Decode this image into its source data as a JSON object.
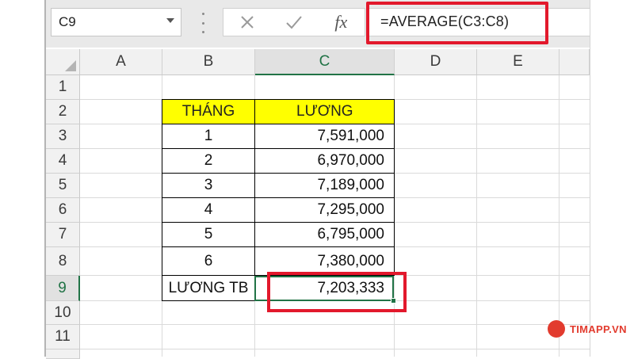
{
  "name_box": {
    "value": "C9"
  },
  "formula_bar": {
    "cancel_icon": "close-icon",
    "enter_icon": "check-icon",
    "function_label": "fx",
    "formula": "=AVERAGE(C3:C8)"
  },
  "columns": [
    "A",
    "B",
    "C",
    "D",
    "E"
  ],
  "selected_column": "C",
  "rows": [
    "1",
    "2",
    "3",
    "4",
    "5",
    "6",
    "7",
    "8",
    "9",
    "10",
    "11"
  ],
  "selected_row": "9",
  "table": {
    "headers": {
      "month": "THÁNG",
      "salary": "LƯƠNG"
    },
    "rows": [
      {
        "month": "1",
        "salary": "7,591,000"
      },
      {
        "month": "2",
        "salary": "6,970,000"
      },
      {
        "month": "3",
        "salary": "7,189,000"
      },
      {
        "month": "4",
        "salary": "7,295,000"
      },
      {
        "month": "5",
        "salary": "6,795,000"
      },
      {
        "month": "6",
        "salary": "7,380,000"
      }
    ],
    "summary": {
      "label": "LƯƠNG TB",
      "value": "7,203,333"
    }
  },
  "colors": {
    "header_fill": "#ffff00",
    "selection": "#217346",
    "highlight": "#e2192c"
  },
  "watermark": {
    "text": "TIMAPP.VN"
  }
}
